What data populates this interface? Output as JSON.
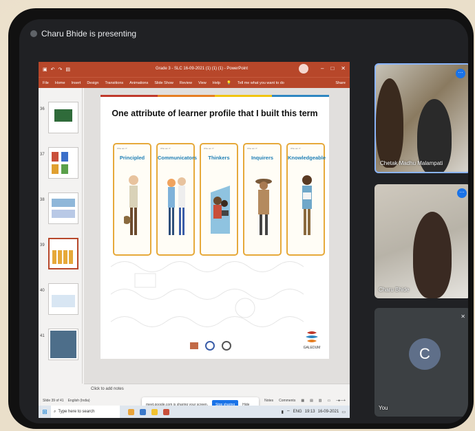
{
  "meet": {
    "presenting_text": "Charu Bhide is presenting",
    "share_notice": "meet.google.com is sharing your screen.",
    "stop_sharing": "Stop sharing",
    "hide": "Hide"
  },
  "ppt": {
    "doc_title": "Grade 3 - SLC 16-09-2021 (1) (1) (1) - PowerPoint",
    "ribbon_tabs": [
      "File",
      "Home",
      "Insert",
      "Design",
      "Transitions",
      "Animations",
      "Slide Show",
      "Review",
      "View",
      "Help"
    ],
    "tell_me": "Tell me what you want to do",
    "share": "Share",
    "slide_numbers": [
      "36",
      "37",
      "38",
      "39",
      "40",
      "41"
    ],
    "notes_placeholder": "Click to add notes",
    "status_slide": "Slide 39 of 41",
    "status_lang": "English (India)",
    "status_notes": "Notes",
    "status_comments": "Comments"
  },
  "slide": {
    "title": "One attribute of learner profile that I built this term",
    "cards": [
      "Principled",
      "Communicators",
      "Thinkers",
      "Inquirers",
      "Knowledgeable"
    ],
    "card_small": "Who am I?",
    "school": "GALEDUM"
  },
  "taskbar": {
    "search_placeholder": "Type here to search",
    "time": "19:13",
    "date": "16-09-2021",
    "lang": "ENG"
  },
  "participants": [
    {
      "name": "Chetak Madhu Malampati"
    },
    {
      "name": "Charu Bhide"
    },
    {
      "name": "You",
      "initial": "C"
    }
  ],
  "colors": {
    "ppt_red": "#b7472a",
    "card_border": "#e6a93a",
    "card_label": "#1f7fb5",
    "meet_blue": "#1a73e8"
  }
}
